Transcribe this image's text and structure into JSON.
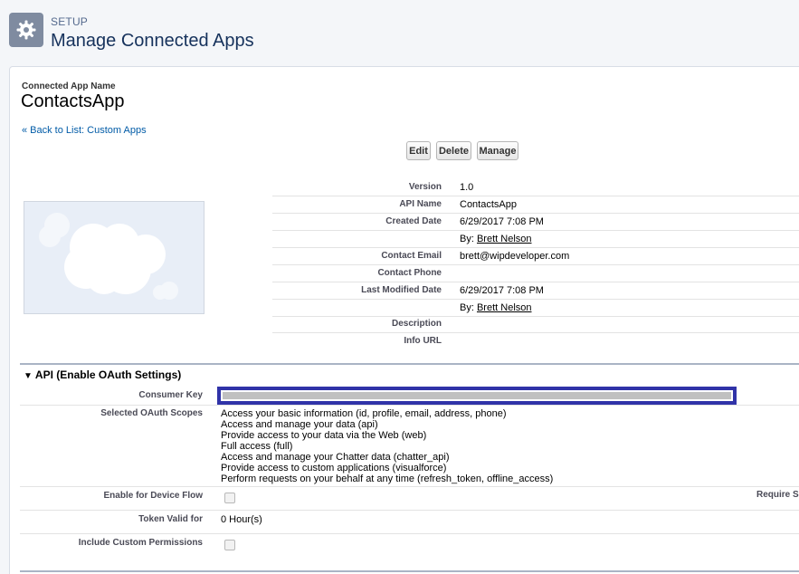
{
  "header": {
    "setup_label": "SETUP",
    "title": "Manage Connected Apps",
    "icon": "gear-icon"
  },
  "app": {
    "name_label": "Connected App Name",
    "name": "ContactsApp",
    "back_link": "« Back to List: Custom Apps"
  },
  "buttons": {
    "edit": "Edit",
    "delete": "Delete",
    "manage": "Manage"
  },
  "details": [
    {
      "label": "Version",
      "value": "1.0"
    },
    {
      "label": "API Name",
      "value": "ContactsApp"
    },
    {
      "label": "Created Date",
      "value": "6/29/2017 7:08 PM"
    },
    {
      "label": "",
      "by": "By:",
      "link": "Brett Nelson"
    },
    {
      "label": "Contact Email",
      "value": "brett@wipdeveloper.com"
    },
    {
      "label": "Contact Phone",
      "value": ""
    },
    {
      "label": "Last Modified Date",
      "value": "6/29/2017 7:08 PM"
    },
    {
      "label": "",
      "by": "By:",
      "link": "Brett Nelson"
    },
    {
      "label": "Description",
      "value": ""
    },
    {
      "label": "Info URL",
      "value": ""
    }
  ],
  "oauth": {
    "section_title": "API (Enable OAuth Settings)",
    "consumer_key_label": "Consumer Key",
    "scopes_label": "Selected OAuth Scopes",
    "scopes": [
      "Access your basic information (id, profile, email, address, phone)",
      "Access and manage your data (api)",
      "Provide access to your data via the Web (web)",
      "Full access (full)",
      "Access and manage your Chatter data (chatter_api)",
      "Provide access to custom applications (visualforce)",
      "Perform requests on your behalf at any time (refresh_token, offline_access)"
    ],
    "device_flow_label": "Enable for Device Flow",
    "require_label": "Require S",
    "token_valid_label": "Token Valid for",
    "token_valid_value": "0 Hour(s)",
    "custom_perms_label": "Include Custom Permissions"
  },
  "colors": {
    "page_bg": "#f4f6f9",
    "key_highlight": "#3033a8",
    "link": "#015ba7",
    "section_line": "#aab4c5"
  }
}
